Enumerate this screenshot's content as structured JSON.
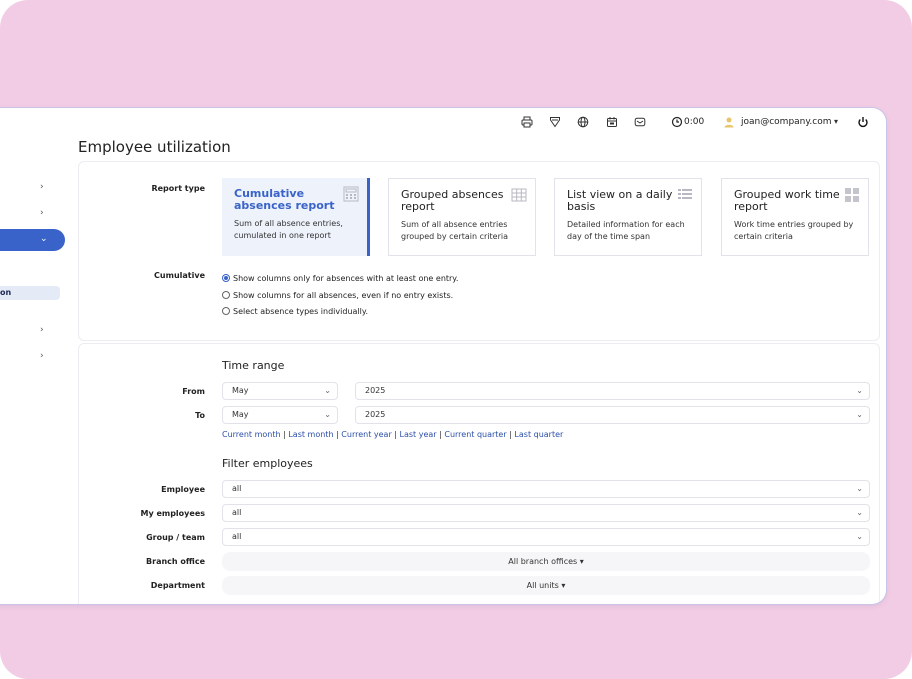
{
  "topbar": {
    "icons": [
      "printer-icon",
      "filter-icon",
      "globe-icon",
      "calendar-icon",
      "mail-icon"
    ],
    "clock": "0:00",
    "user": "joan@company.com"
  },
  "sidebar": {
    "sub_label": "on",
    "chevrons": [
      "›",
      "›",
      "›",
      "›"
    ]
  },
  "page": {
    "title": "Employee utilization"
  },
  "report": {
    "type_label": "Report type",
    "tiles": [
      {
        "title": "Cumulative absences report",
        "desc": "Sum of all absence entries, cumulated in one report",
        "icon": "calculator-icon",
        "active": true
      },
      {
        "title": "Grouped absences report",
        "desc": "Sum of all absence entries grouped by certain criteria",
        "icon": "table-icon",
        "active": false
      },
      {
        "title": "List view on a daily basis",
        "desc": "Detailed information for each day of the time span",
        "icon": "list-icon",
        "active": false
      },
      {
        "title": "Grouped work time report",
        "desc": "Work time entries grouped by certain criteria",
        "icon": "grid-icon",
        "active": false
      }
    ],
    "cumulative_label": "Cumulative",
    "options": [
      {
        "label": "Show columns only for absences with at least one entry.",
        "selected": true
      },
      {
        "label": "Show columns for all absences, even if no entry exists.",
        "selected": false
      },
      {
        "label": "Select absence types individually.",
        "selected": false
      }
    ]
  },
  "timerange": {
    "title": "Time range",
    "from_label": "From",
    "to_label": "To",
    "from_month": "May",
    "from_year": "2025",
    "to_month": "May",
    "to_year": "2025",
    "links": [
      "Current month",
      "Last month",
      "Current year",
      "Last year",
      "Current quarter",
      "Last quarter"
    ]
  },
  "filters": {
    "title": "Filter employees",
    "employee_label": "Employee",
    "employee_value": "all",
    "my_employees_label": "My employees",
    "my_employees_value": "all",
    "group_label": "Group / team",
    "group_value": "all",
    "branch_label": "Branch office",
    "branch_value": "All branch offices",
    "department_label": "Department",
    "department_value": "All units"
  },
  "colors": {
    "accent": "#3a63c9",
    "frame": "#f2cce4",
    "link": "#2c4fa8"
  }
}
